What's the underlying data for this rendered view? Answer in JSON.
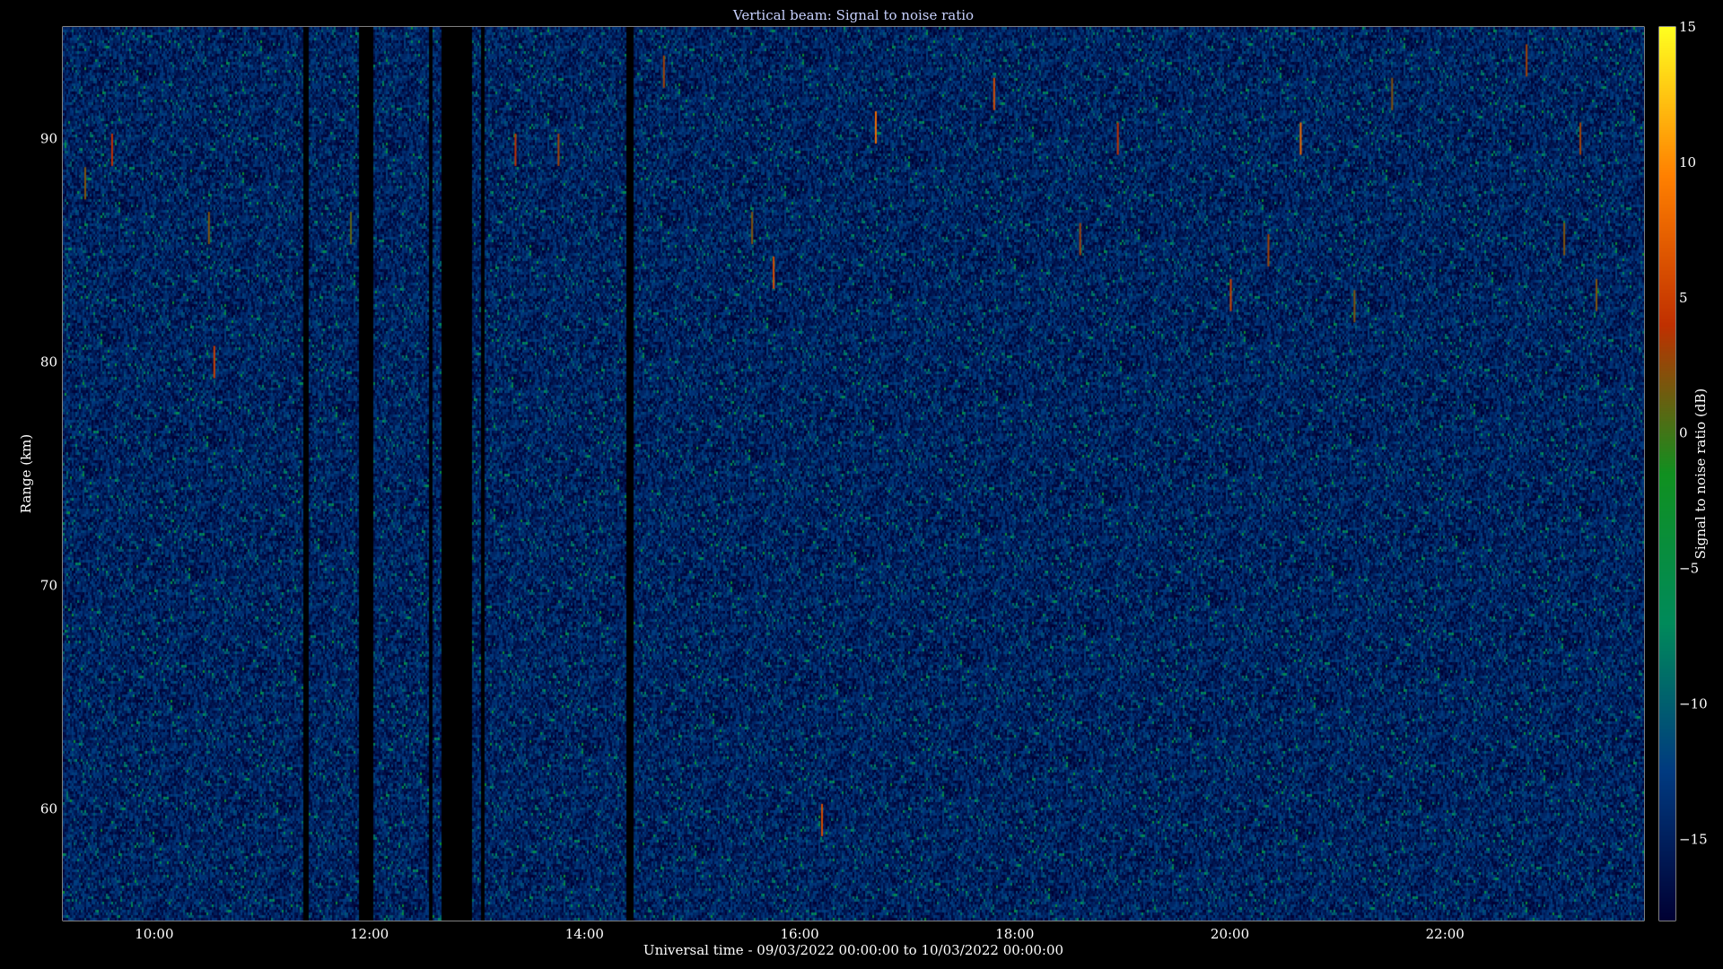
{
  "chart_data": {
    "type": "heatmap",
    "title": "Vertical beam: Signal to noise ratio",
    "xlabel": "Universal time - 09/03/2022 00:00:00 to 10/03/2022 00:00:00",
    "ylabel": "Range (km)",
    "x_range_hours": [
      9.15,
      23.85
    ],
    "y_range_km": [
      55,
      95
    ],
    "x_ticks": [
      {
        "value": 10,
        "label": "10:00"
      },
      {
        "value": 12,
        "label": "12:00"
      },
      {
        "value": 14,
        "label": "14:00"
      },
      {
        "value": 16,
        "label": "16:00"
      },
      {
        "value": 18,
        "label": "18:00"
      },
      {
        "value": 20,
        "label": "20:00"
      },
      {
        "value": 22,
        "label": "22:00"
      }
    ],
    "y_ticks": [
      {
        "value": 60,
        "label": "60"
      },
      {
        "value": 70,
        "label": "70"
      },
      {
        "value": 80,
        "label": "80"
      },
      {
        "value": 90,
        "label": "90"
      }
    ],
    "colorbar": {
      "label": "Signal to noise ratio (dB)",
      "range": [
        -18,
        15
      ],
      "ticks": [
        {
          "value": 15,
          "label": "15"
        },
        {
          "value": 10,
          "label": "10"
        },
        {
          "value": 5,
          "label": "5"
        },
        {
          "value": 0,
          "label": "0"
        },
        {
          "value": -5,
          "label": "−5"
        },
        {
          "value": -10,
          "label": "−10"
        },
        {
          "value": -15,
          "label": "−15"
        }
      ],
      "colors": [
        "#000033",
        "#003a80",
        "#008a5a",
        "#109020",
        "#c03000",
        "#ff8000",
        "#ffff20"
      ]
    },
    "data_gaps_hours": [
      [
        11.37,
        11.43
      ],
      [
        11.9,
        12.02
      ],
      [
        12.55,
        12.58
      ],
      [
        12.67,
        12.95
      ],
      [
        13.03,
        13.06
      ],
      [
        14.38,
        14.45
      ]
    ],
    "notable_echoes": [
      {
        "time": 9.35,
        "range_km": 88.0,
        "snr_db": 2
      },
      {
        "time": 9.6,
        "range_km": 89.5,
        "snr_db": 4
      },
      {
        "time": 10.5,
        "range_km": 86.0,
        "snr_db": 2
      },
      {
        "time": 10.55,
        "range_km": 80.0,
        "snr_db": 5
      },
      {
        "time": 11.82,
        "range_km": 86.0,
        "snr_db": 1
      },
      {
        "time": 13.35,
        "range_km": 89.5,
        "snr_db": 4
      },
      {
        "time": 13.75,
        "range_km": 89.5,
        "snr_db": 3
      },
      {
        "time": 14.73,
        "range_km": 93.0,
        "snr_db": 3
      },
      {
        "time": 15.55,
        "range_km": 86.0,
        "snr_db": 2
      },
      {
        "time": 15.75,
        "range_km": 84.0,
        "snr_db": 6
      },
      {
        "time": 16.2,
        "range_km": 59.5,
        "snr_db": 6
      },
      {
        "time": 16.7,
        "range_km": 90.5,
        "snr_db": 8
      },
      {
        "time": 17.8,
        "range_km": 92.0,
        "snr_db": 6
      },
      {
        "time": 18.6,
        "range_km": 85.5,
        "snr_db": 3
      },
      {
        "time": 18.95,
        "range_km": 90.0,
        "snr_db": 4
      },
      {
        "time": 20.0,
        "range_km": 83.0,
        "snr_db": 5
      },
      {
        "time": 20.35,
        "range_km": 85.0,
        "snr_db": 3
      },
      {
        "time": 20.65,
        "range_km": 90.0,
        "snr_db": 8
      },
      {
        "time": 21.15,
        "range_km": 82.5,
        "snr_db": 2
      },
      {
        "time": 21.5,
        "range_km": 92.0,
        "snr_db": 2
      },
      {
        "time": 22.75,
        "range_km": 93.5,
        "snr_db": 3
      },
      {
        "time": 23.1,
        "range_km": 85.5,
        "snr_db": 2
      },
      {
        "time": 23.25,
        "range_km": 90.0,
        "snr_db": 3
      },
      {
        "time": 23.4,
        "range_km": 83.0,
        "snr_db": 2
      }
    ]
  }
}
